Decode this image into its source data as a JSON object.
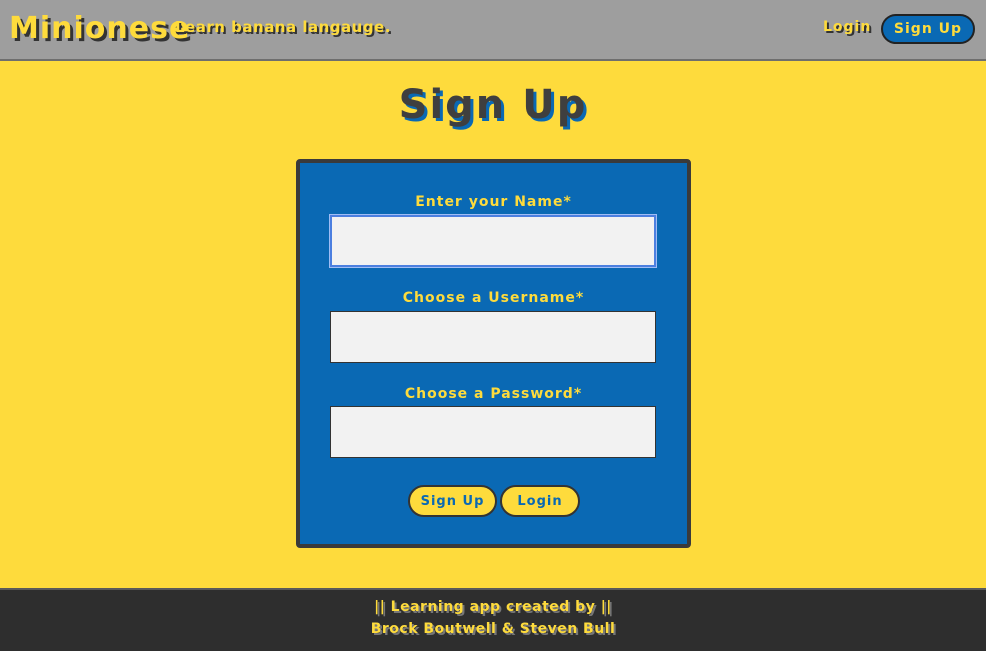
{
  "header": {
    "brand": "Minionese",
    "tagline": "Learn banana langauge.",
    "login_label": "Login",
    "signup_label": "Sign Up"
  },
  "main": {
    "title": "Sign Up",
    "form": {
      "name_label": "Enter your Name*",
      "name_value": "",
      "username_label": "Choose a Username*",
      "username_value": "",
      "password_label": "Choose a Password*",
      "password_value": "",
      "signup_button": "Sign Up",
      "login_button": "Login"
    }
  },
  "footer": {
    "line1": "|| Learning app created by ||",
    "line2": "Brock Boutwell & Steven Bull"
  },
  "colors": {
    "background": "#fedb3c",
    "header": "#9e9e9e",
    "accent_blue": "#0a69b4",
    "footer": "#2e2e2e"
  }
}
